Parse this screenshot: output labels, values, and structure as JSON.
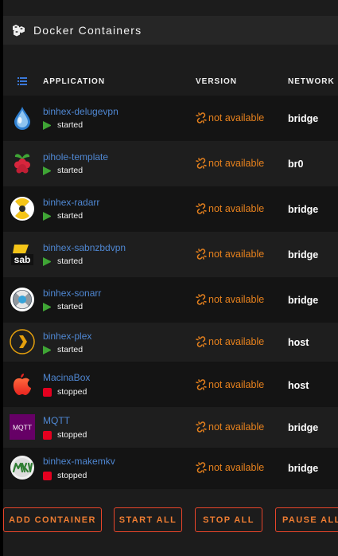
{
  "title": "Docker Containers",
  "columns": {
    "application": "APPLICATION",
    "version": "VERSION",
    "network": "NETWORK"
  },
  "containers": [
    {
      "name": "binhex-delugevpn",
      "status": "started",
      "version": "not available",
      "network": "bridge",
      "icon": "deluge-icon"
    },
    {
      "name": "pihole-template",
      "status": "started",
      "version": "not available",
      "network": "br0",
      "icon": "raspberry-icon"
    },
    {
      "name": "binhex-radarr",
      "status": "started",
      "version": "not available",
      "network": "bridge",
      "icon": "radarr-icon"
    },
    {
      "name": "binhex-sabnzbdvpn",
      "status": "started",
      "version": "not available",
      "network": "bridge",
      "icon": "sabnzbd-icon"
    },
    {
      "name": "binhex-sonarr",
      "status": "started",
      "version": "not available",
      "network": "bridge",
      "icon": "sonarr-icon"
    },
    {
      "name": "binhex-plex",
      "status": "started",
      "version": "not available",
      "network": "host",
      "icon": "plex-icon"
    },
    {
      "name": "MacinaBox",
      "status": "stopped",
      "version": "not available",
      "network": "host",
      "icon": "apple-icon"
    },
    {
      "name": "MQTT",
      "status": "stopped",
      "version": "not available",
      "network": "bridge",
      "icon": "mqtt-icon",
      "icon_text": "MQTT"
    },
    {
      "name": "binhex-makemkv",
      "status": "stopped",
      "version": "not available",
      "network": "bridge",
      "icon": "makemkv-icon"
    }
  ],
  "icon_labels": {
    "sab": "sab"
  },
  "buttons": {
    "add": "ADD CONTAINER",
    "start": "START ALL",
    "stop": "STOP ALL",
    "pause": "PAUSE ALL"
  },
  "colors": {
    "link": "#4f87d2",
    "started": "#3fa535",
    "stopped": "#e5001f",
    "version": "#e8821d",
    "button": "#e8452a"
  }
}
